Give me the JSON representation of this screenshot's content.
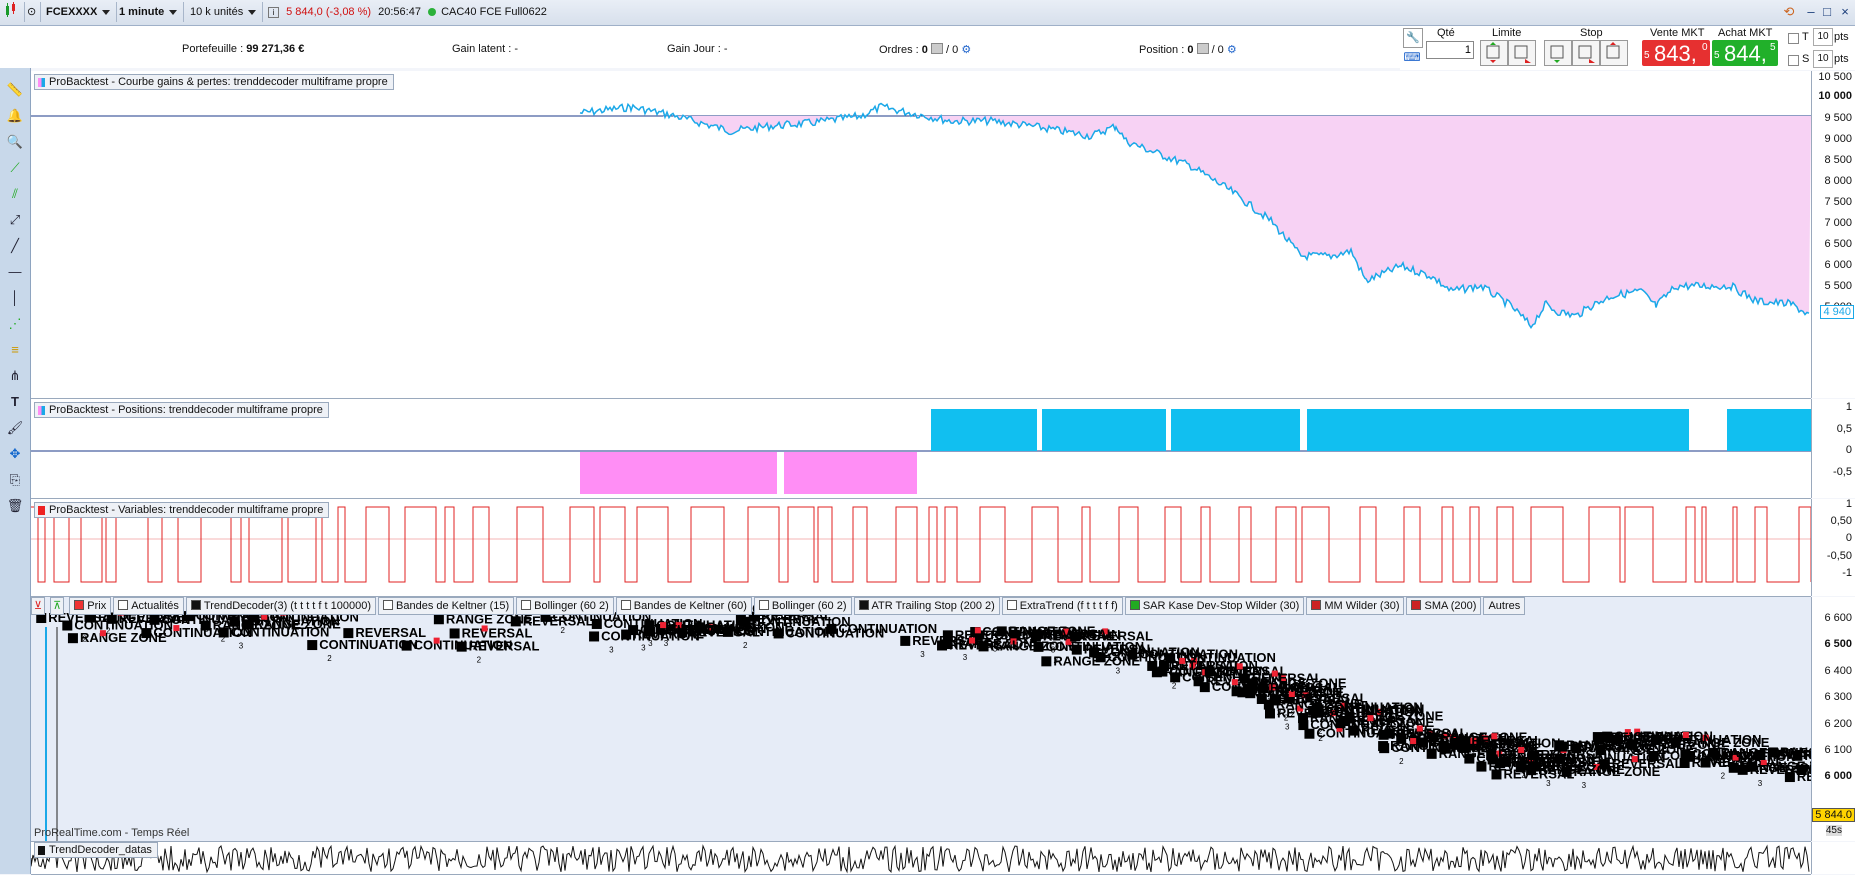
{
  "topbar": {
    "instrument": "FCEXXXX",
    "timeframe": "1 minute",
    "units": "10 k unités",
    "change": "5 844,0 (-3,08 %)",
    "time": "20:56:47",
    "market": "CAC40 FCE Full0622"
  },
  "infobar": {
    "portefeuille_label": "Portefeuille :",
    "portefeuille_value": "99 271,36 €",
    "gain_latent_label": "Gain latent :",
    "gain_latent_value": "-",
    "gain_jour_label": "Gain Jour :",
    "gain_jour_value": "-",
    "ordres_label": "Ordres :",
    "ordres_a": "0",
    "ordres_b": "/ 0",
    "position_label": "Position :",
    "position_a": "0",
    "position_b": "/ 0"
  },
  "trade": {
    "qty_label": "Qté",
    "qty_value": "1",
    "limit_label": "Limite",
    "stop_label": "Stop",
    "sell_label": "Vente MKT",
    "sell_prefix": "5",
    "sell_price": "843,",
    "sell_sup": "0",
    "buy_label": "Achat MKT",
    "buy_prefix": "5",
    "buy_price": "844,",
    "buy_sup": "5",
    "t_label": "T",
    "t_value": "10",
    "s_label": "S",
    "s_value": "10",
    "pts": "pts"
  },
  "panels": {
    "equity_title": "ProBacktest - Courbe gains & pertes: trenddecoder multiframe propre",
    "positions_title": "ProBacktest - Positions: trenddecoder multiframe propre",
    "variables_title": "ProBacktest - Variables: trenddecoder multiframe propre",
    "datas_title": "TrendDecoder_datas",
    "watermark": "ProRealTime.com - Temps Réel"
  },
  "axes": {
    "equity": [
      "10 500",
      "10 000",
      "9 500",
      "9 000",
      "8 500",
      "8 000",
      "7 500",
      "7 000",
      "6 500",
      "6 000",
      "5 500",
      "5 000"
    ],
    "equity_last": "4 940",
    "positions": [
      "1",
      "0,5",
      "0",
      "-0,5"
    ],
    "variables": [
      "1",
      "0,50",
      "0",
      "-0,50",
      "-1"
    ],
    "price": [
      "6 600",
      "6 500",
      "6 400",
      "6 300",
      "6 200",
      "6 100",
      "6 000"
    ],
    "price_last": "5 844.0",
    "countdown": "45s"
  },
  "indicators": [
    "Prix",
    "Actualités",
    "TrendDecoder(3) (t t t t f t 100000)",
    "Bandes de Keltner (15)",
    "Bollinger (60 2)",
    "Bandes de Keltner (60)",
    "Bollinger (60 2)",
    "ATR Trailing Stop (200 2)",
    "ExtraTrend (f t t t f f)",
    "SAR Kase Dev-Stop Wilder (30)",
    "MM Wilder (30)",
    "SMA (200)",
    "Autres"
  ],
  "chart_labels": [
    "REVERSAL",
    "RANGE ZONE",
    "CONTINUATION",
    "2",
    "3"
  ],
  "colors": {
    "equity_line": "#1aa8e8",
    "loss_fill": "#f7d2f4",
    "long_block": "#11bff0",
    "short_block": "#ff8ef5",
    "variable_line": "#e22222",
    "sell": "#e63030",
    "buy": "#21b02a"
  }
}
